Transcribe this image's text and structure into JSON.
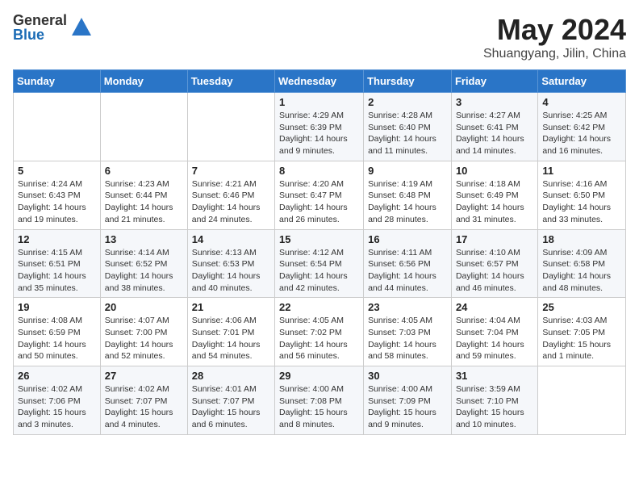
{
  "logo": {
    "general": "General",
    "blue": "Blue"
  },
  "title": "May 2024",
  "location": "Shuangyang, Jilin, China",
  "days_of_week": [
    "Sunday",
    "Monday",
    "Tuesday",
    "Wednesday",
    "Thursday",
    "Friday",
    "Saturday"
  ],
  "weeks": [
    [
      {
        "day": "",
        "info": ""
      },
      {
        "day": "",
        "info": ""
      },
      {
        "day": "",
        "info": ""
      },
      {
        "day": "1",
        "info": "Sunrise: 4:29 AM\nSunset: 6:39 PM\nDaylight: 14 hours\nand 9 minutes."
      },
      {
        "day": "2",
        "info": "Sunrise: 4:28 AM\nSunset: 6:40 PM\nDaylight: 14 hours\nand 11 minutes."
      },
      {
        "day": "3",
        "info": "Sunrise: 4:27 AM\nSunset: 6:41 PM\nDaylight: 14 hours\nand 14 minutes."
      },
      {
        "day": "4",
        "info": "Sunrise: 4:25 AM\nSunset: 6:42 PM\nDaylight: 14 hours\nand 16 minutes."
      }
    ],
    [
      {
        "day": "5",
        "info": "Sunrise: 4:24 AM\nSunset: 6:43 PM\nDaylight: 14 hours\nand 19 minutes."
      },
      {
        "day": "6",
        "info": "Sunrise: 4:23 AM\nSunset: 6:44 PM\nDaylight: 14 hours\nand 21 minutes."
      },
      {
        "day": "7",
        "info": "Sunrise: 4:21 AM\nSunset: 6:46 PM\nDaylight: 14 hours\nand 24 minutes."
      },
      {
        "day": "8",
        "info": "Sunrise: 4:20 AM\nSunset: 6:47 PM\nDaylight: 14 hours\nand 26 minutes."
      },
      {
        "day": "9",
        "info": "Sunrise: 4:19 AM\nSunset: 6:48 PM\nDaylight: 14 hours\nand 28 minutes."
      },
      {
        "day": "10",
        "info": "Sunrise: 4:18 AM\nSunset: 6:49 PM\nDaylight: 14 hours\nand 31 minutes."
      },
      {
        "day": "11",
        "info": "Sunrise: 4:16 AM\nSunset: 6:50 PM\nDaylight: 14 hours\nand 33 minutes."
      }
    ],
    [
      {
        "day": "12",
        "info": "Sunrise: 4:15 AM\nSunset: 6:51 PM\nDaylight: 14 hours\nand 35 minutes."
      },
      {
        "day": "13",
        "info": "Sunrise: 4:14 AM\nSunset: 6:52 PM\nDaylight: 14 hours\nand 38 minutes."
      },
      {
        "day": "14",
        "info": "Sunrise: 4:13 AM\nSunset: 6:53 PM\nDaylight: 14 hours\nand 40 minutes."
      },
      {
        "day": "15",
        "info": "Sunrise: 4:12 AM\nSunset: 6:54 PM\nDaylight: 14 hours\nand 42 minutes."
      },
      {
        "day": "16",
        "info": "Sunrise: 4:11 AM\nSunset: 6:56 PM\nDaylight: 14 hours\nand 44 minutes."
      },
      {
        "day": "17",
        "info": "Sunrise: 4:10 AM\nSunset: 6:57 PM\nDaylight: 14 hours\nand 46 minutes."
      },
      {
        "day": "18",
        "info": "Sunrise: 4:09 AM\nSunset: 6:58 PM\nDaylight: 14 hours\nand 48 minutes."
      }
    ],
    [
      {
        "day": "19",
        "info": "Sunrise: 4:08 AM\nSunset: 6:59 PM\nDaylight: 14 hours\nand 50 minutes."
      },
      {
        "day": "20",
        "info": "Sunrise: 4:07 AM\nSunset: 7:00 PM\nDaylight: 14 hours\nand 52 minutes."
      },
      {
        "day": "21",
        "info": "Sunrise: 4:06 AM\nSunset: 7:01 PM\nDaylight: 14 hours\nand 54 minutes."
      },
      {
        "day": "22",
        "info": "Sunrise: 4:05 AM\nSunset: 7:02 PM\nDaylight: 14 hours\nand 56 minutes."
      },
      {
        "day": "23",
        "info": "Sunrise: 4:05 AM\nSunset: 7:03 PM\nDaylight: 14 hours\nand 58 minutes."
      },
      {
        "day": "24",
        "info": "Sunrise: 4:04 AM\nSunset: 7:04 PM\nDaylight: 14 hours\nand 59 minutes."
      },
      {
        "day": "25",
        "info": "Sunrise: 4:03 AM\nSunset: 7:05 PM\nDaylight: 15 hours\nand 1 minute."
      }
    ],
    [
      {
        "day": "26",
        "info": "Sunrise: 4:02 AM\nSunset: 7:06 PM\nDaylight: 15 hours\nand 3 minutes."
      },
      {
        "day": "27",
        "info": "Sunrise: 4:02 AM\nSunset: 7:07 PM\nDaylight: 15 hours\nand 4 minutes."
      },
      {
        "day": "28",
        "info": "Sunrise: 4:01 AM\nSunset: 7:07 PM\nDaylight: 15 hours\nand 6 minutes."
      },
      {
        "day": "29",
        "info": "Sunrise: 4:00 AM\nSunset: 7:08 PM\nDaylight: 15 hours\nand 8 minutes."
      },
      {
        "day": "30",
        "info": "Sunrise: 4:00 AM\nSunset: 7:09 PM\nDaylight: 15 hours\nand 9 minutes."
      },
      {
        "day": "31",
        "info": "Sunrise: 3:59 AM\nSunset: 7:10 PM\nDaylight: 15 hours\nand 10 minutes."
      },
      {
        "day": "",
        "info": ""
      }
    ]
  ]
}
